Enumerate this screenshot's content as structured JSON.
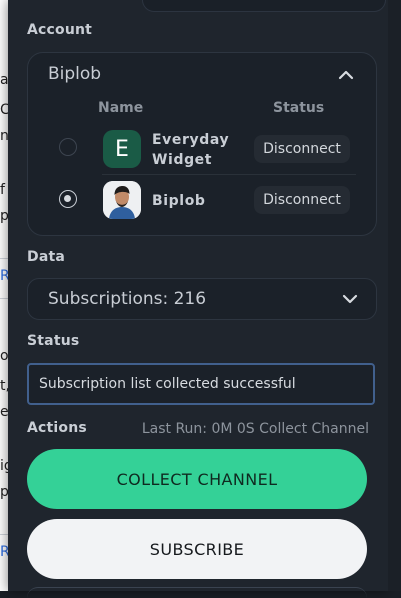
{
  "background_fragments": [
    "a",
    "Cr",
    "na",
    "f",
    "p",
    "R",
    "o",
    "t,",
    "e",
    "ig",
    "p",
    "R"
  ],
  "account": {
    "section_label": "Account",
    "title": "Biplob",
    "col_name": "Name",
    "col_status": "Status",
    "rows": [
      {
        "avatar_letter": "E",
        "name": "Everyday Widget",
        "button": "Disconnect",
        "selected": false
      },
      {
        "avatar_letter": "",
        "name": "Biplob",
        "button": "Disconnect",
        "selected": true
      }
    ]
  },
  "data": {
    "section_label": "Data",
    "value": "Subscriptions: 216"
  },
  "status": {
    "section_label": "Status",
    "value": "Subscription list collected successful"
  },
  "actions": {
    "section_label": "Actions",
    "last_run": "Last Run: 0M 0S Collect Channel",
    "collect_label": "COLLECT CHANNEL",
    "subscribe_label": "SUBSCRIBE"
  },
  "colors": {
    "panel_bg": "#1f252d",
    "accent_green": "#34d197",
    "input_border": "#41608d"
  }
}
